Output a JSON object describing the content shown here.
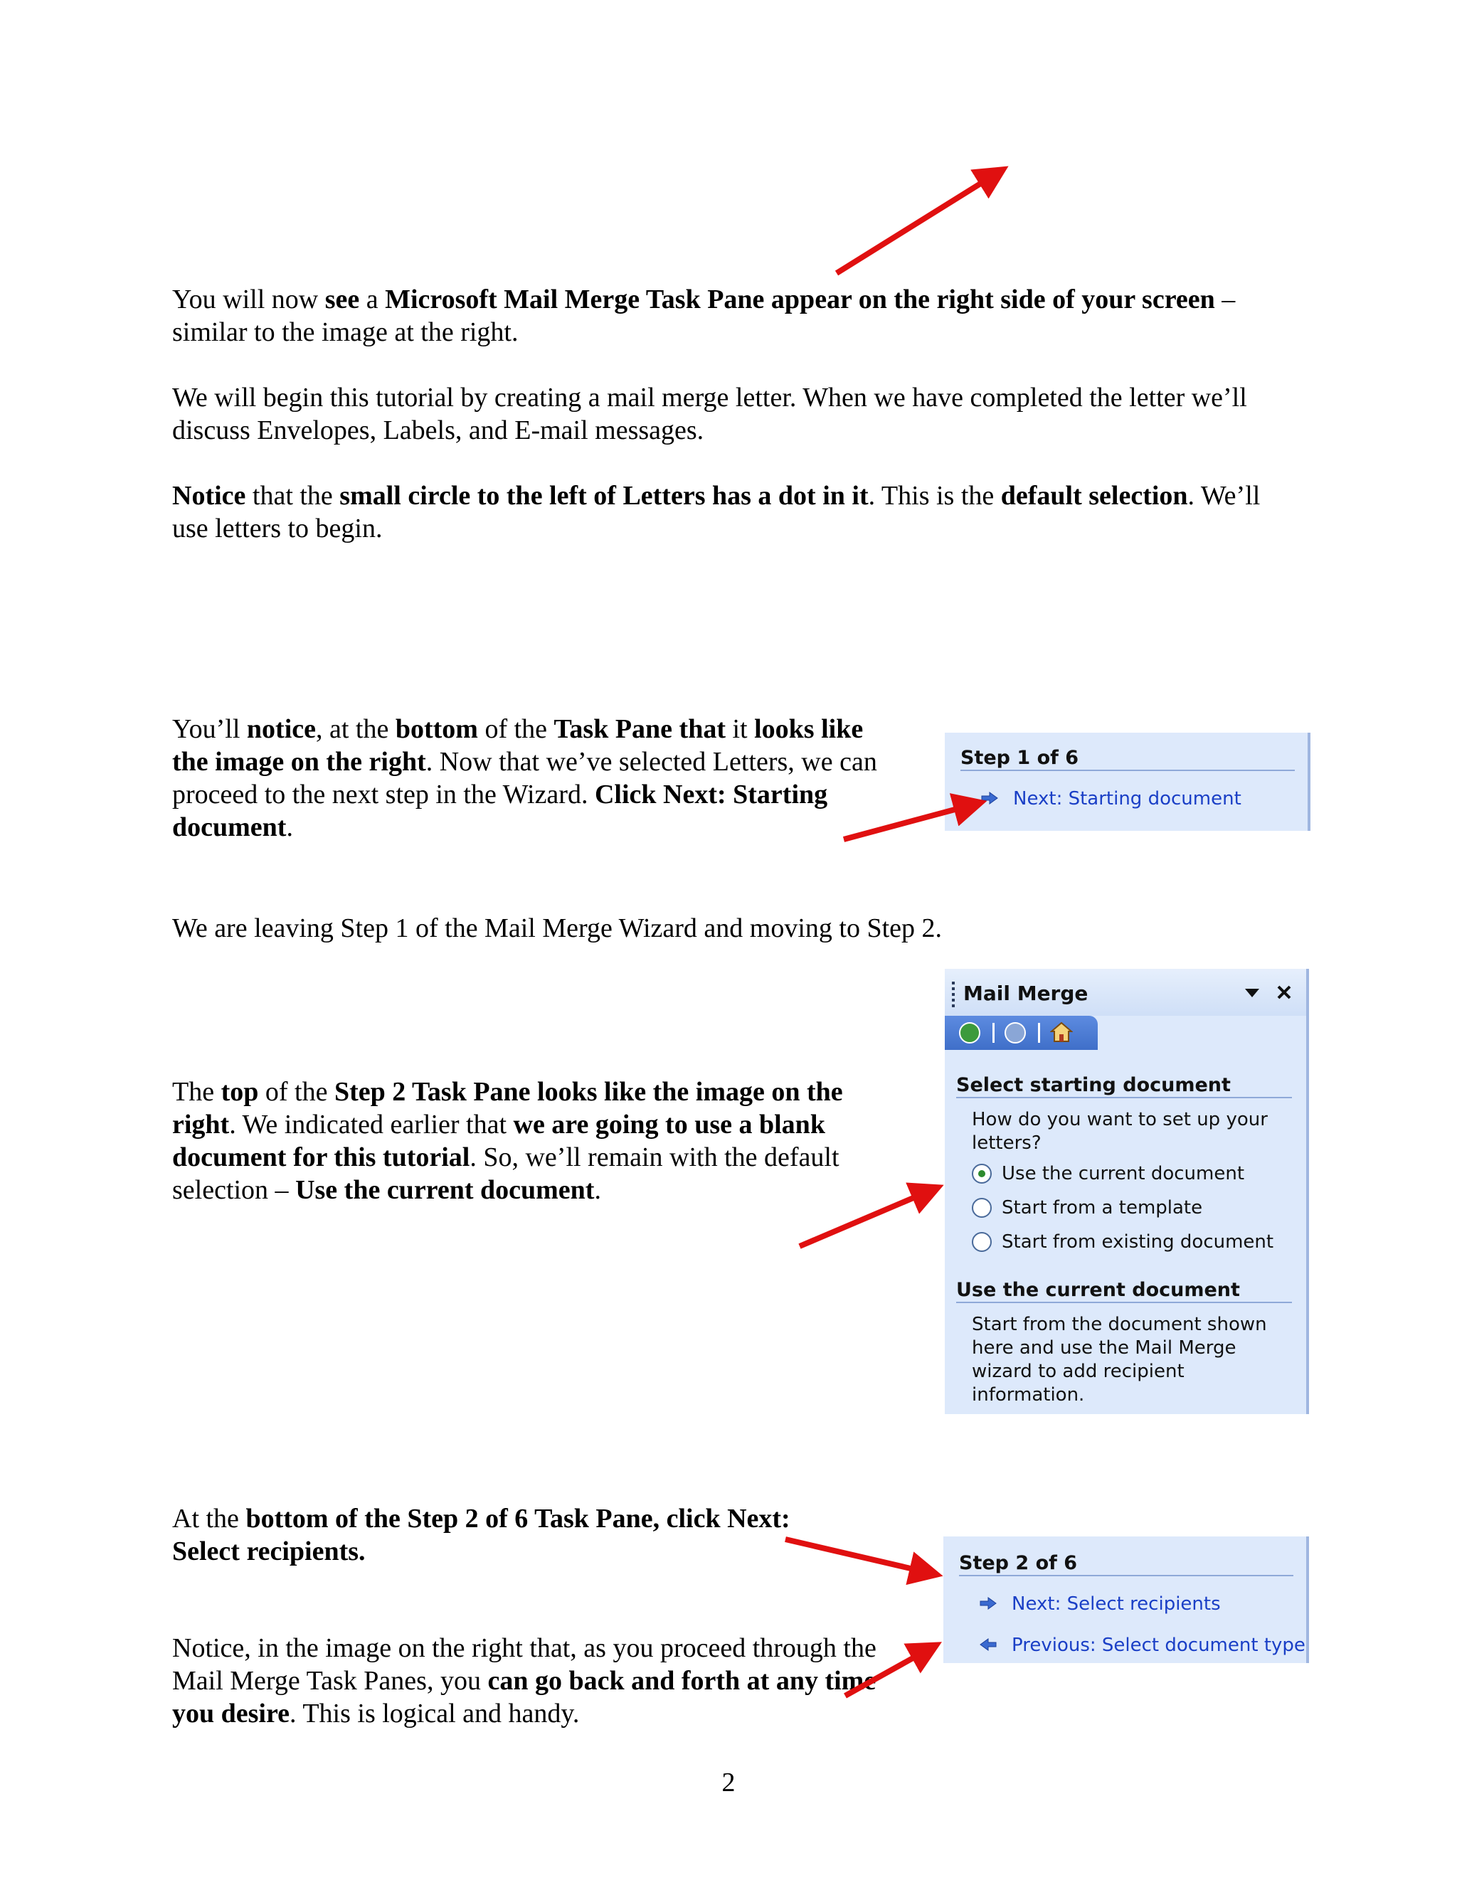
{
  "paragraphs": {
    "p1": [
      {
        "t": "You will now ",
        "b": false
      },
      {
        "t": "see",
        "b": true
      },
      {
        "t": " a ",
        "b": false
      },
      {
        "t": "Microsoft Mail Merge Task Pane appear on the right side of your screen",
        "b": true
      },
      {
        "t": " – similar to the image at the right.",
        "b": false
      }
    ],
    "p2": [
      {
        "t": "We will begin this tutorial by creating a mail merge letter.  When we have completed the letter we’ll discuss Envelopes, Labels, and E-mail messages.",
        "b": false
      }
    ],
    "p3": [
      {
        "t": "Notice",
        "b": true
      },
      {
        "t": " that the ",
        "b": false
      },
      {
        "t": "small circle to the left of Letters has a dot in it",
        "b": true
      },
      {
        "t": ".  This is the ",
        "b": false
      },
      {
        "t": "default selection",
        "b": true
      },
      {
        "t": ". We’ll use letters to begin.",
        "b": false
      }
    ],
    "p4": [
      {
        "t": "You’ll ",
        "b": false
      },
      {
        "t": "notice",
        "b": true
      },
      {
        "t": ", at the ",
        "b": false
      },
      {
        "t": "bottom",
        "b": true
      },
      {
        "t": " of the ",
        "b": false
      },
      {
        "t": "Task Pane that",
        "b": true
      },
      {
        "t": " it ",
        "b": false
      },
      {
        "t": "looks like the image on the right",
        "b": true
      },
      {
        "t": ".  Now that we’ve selected Letters, we can proceed to the next step in the Wizard.  ",
        "b": false
      },
      {
        "t": "Click Next: Starting document",
        "b": true
      },
      {
        "t": ".",
        "b": false
      }
    ],
    "p5": [
      {
        "t": "We are leaving Step 1 of the Mail Merge Wizard and moving to Step 2.",
        "b": false
      }
    ],
    "p6": [
      {
        "t": "The ",
        "b": false
      },
      {
        "t": "top",
        "b": true
      },
      {
        "t": " of the ",
        "b": false
      },
      {
        "t": "Step 2 Task Pane looks like the image on the right",
        "b": true
      },
      {
        "t": ".  We indicated earlier that ",
        "b": false
      },
      {
        "t": "we are going to use a blank document for this tutorial",
        "b": true
      },
      {
        "t": ".  So, we’ll remain with the default selection – ",
        "b": false
      },
      {
        "t": "Use the current document",
        "b": true
      },
      {
        "t": ".",
        "b": false
      }
    ],
    "p7": [
      {
        "t": "At the ",
        "b": false
      },
      {
        "t": "bottom of the Step 2 of 6 Task Pane, click Next: Select recipients.",
        "b": true
      }
    ],
    "p8": [
      {
        "t": "Notice, in the image on the right that, as you proceed through the Mail Merge Task Panes, you ",
        "b": false
      },
      {
        "t": "can go back and forth at any time you desire",
        "b": true
      },
      {
        "t": ".  This is logical and handy.",
        "b": false
      }
    ]
  },
  "pane_step1": {
    "heading": "Step 1 of 6",
    "next_link": "Next: Starting document"
  },
  "pane_mailmerge": {
    "title": "Mail Merge",
    "section1_heading": "Select starting document",
    "question": "How do you want to set up your letters?",
    "options": [
      "Use the current document",
      "Start from a template",
      "Start from existing document"
    ],
    "selected_option": "Use the current document",
    "section2_heading": "Use the current document",
    "description": "Start from the document shown here and use the Mail Merge wizard to add recipient information."
  },
  "pane_step2": {
    "heading": "Step 2 of 6",
    "next_link": "Next: Select recipients",
    "previous_link": "Previous: Select document type"
  },
  "page_number": "2",
  "colors": {
    "pane_bg": "#dde9fb",
    "link": "#1a3fc6",
    "arrow": "#e01010"
  }
}
